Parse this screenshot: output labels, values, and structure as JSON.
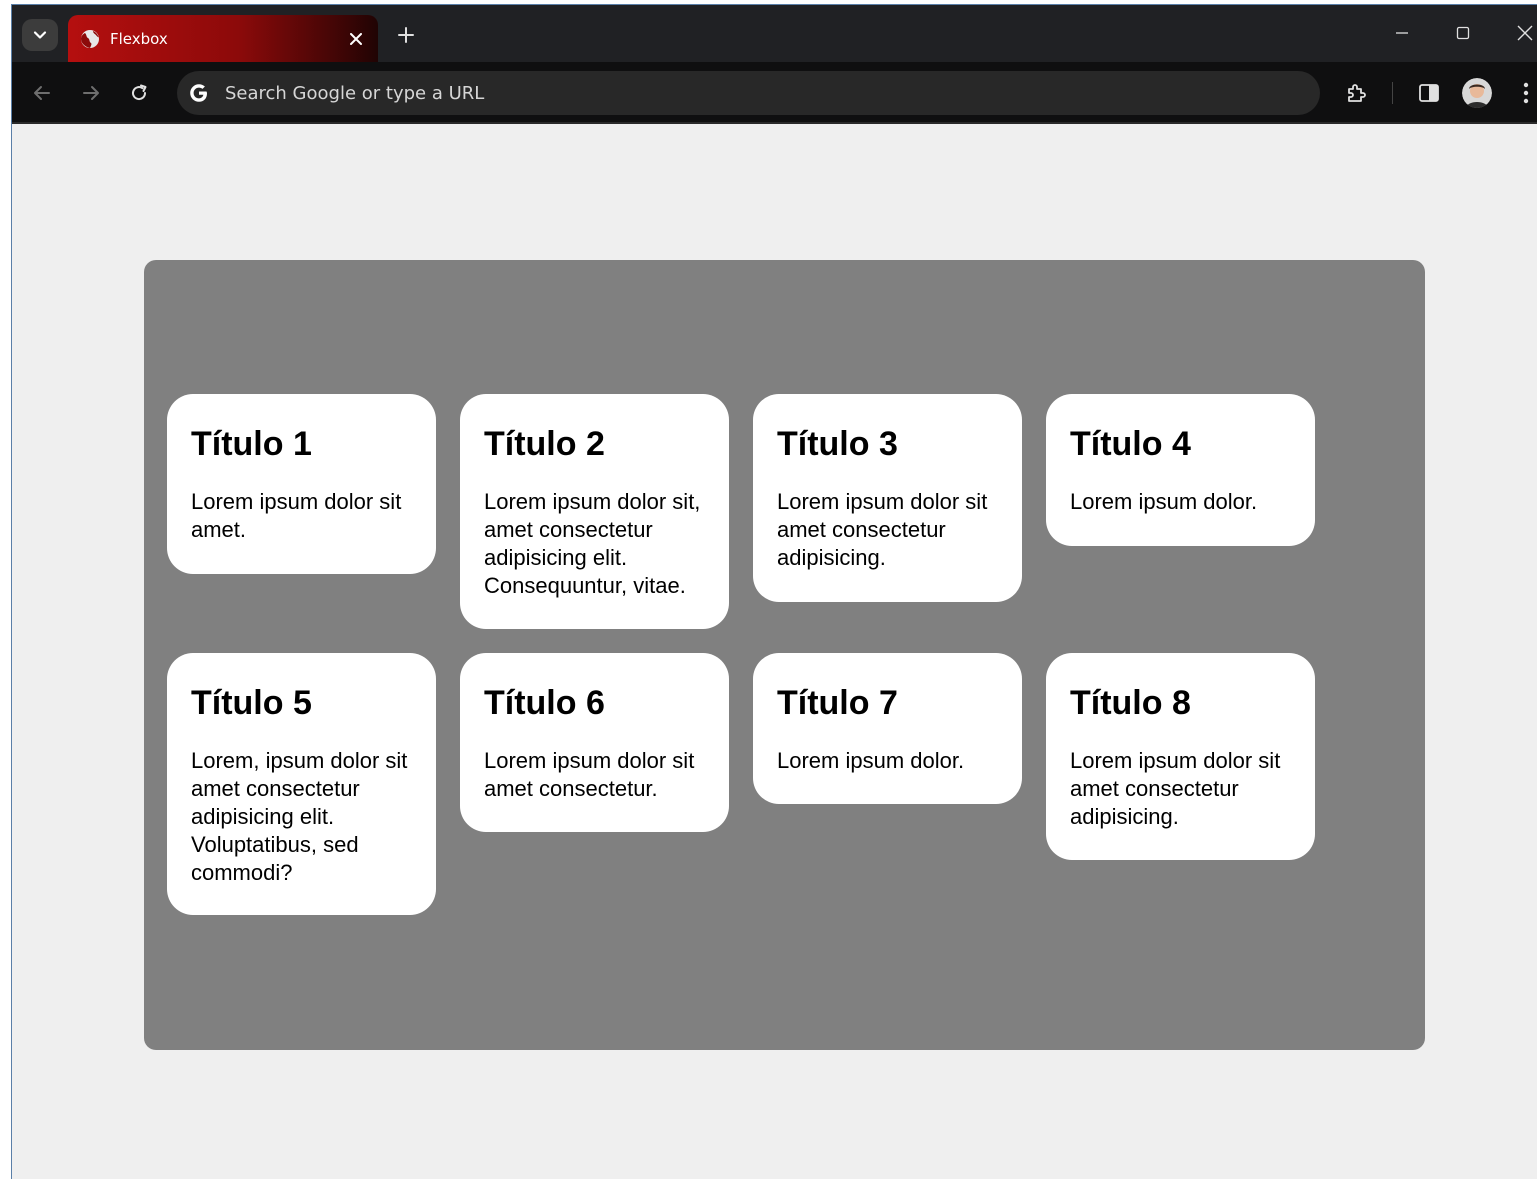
{
  "browser": {
    "tab_title": "Flexbox",
    "omnibox_placeholder": "Search Google or type a URL"
  },
  "cards": [
    {
      "title": "Título 1",
      "text": "Lorem ipsum dolor sit amet."
    },
    {
      "title": "Título 2",
      "text": "Lorem ipsum dolor sit, amet consectetur adipisicing elit. Consequuntur, vitae."
    },
    {
      "title": "Título 3",
      "text": "Lorem ipsum dolor sit amet consectetur adipisicing."
    },
    {
      "title": "Título 4",
      "text": "Lorem ipsum dolor."
    },
    {
      "title": "Título 5",
      "text": "Lorem, ipsum dolor sit amet consectetur adipisicing elit. Voluptatibus, sed commodi?"
    },
    {
      "title": "Título 6",
      "text": "Lorem ipsum dolor sit amet consectetur."
    },
    {
      "title": "Título 7",
      "text": "Lorem ipsum dolor."
    },
    {
      "title": "Título 8",
      "text": "Lorem ipsum dolor sit amet consectetur adipisicing."
    }
  ],
  "colors": {
    "tab_accent": "#b50f0f",
    "container_bg": "#808080",
    "page_bg": "#efefef",
    "card_bg": "#ffffff"
  },
  "icons": {
    "tab_search": "chevron-down-icon",
    "favicon": "globe-icon",
    "tab_close": "close-icon",
    "new_tab": "plus-icon",
    "minimize": "minimize-icon",
    "maximize": "maximize-icon",
    "window_close": "close-icon",
    "back": "arrow-left-icon",
    "forward": "arrow-right-icon",
    "reload": "reload-icon",
    "google": "google-g-icon",
    "extensions": "puzzle-icon",
    "side_panel": "side-panel-icon",
    "profile": "avatar",
    "menu": "kebab-menu-icon"
  }
}
